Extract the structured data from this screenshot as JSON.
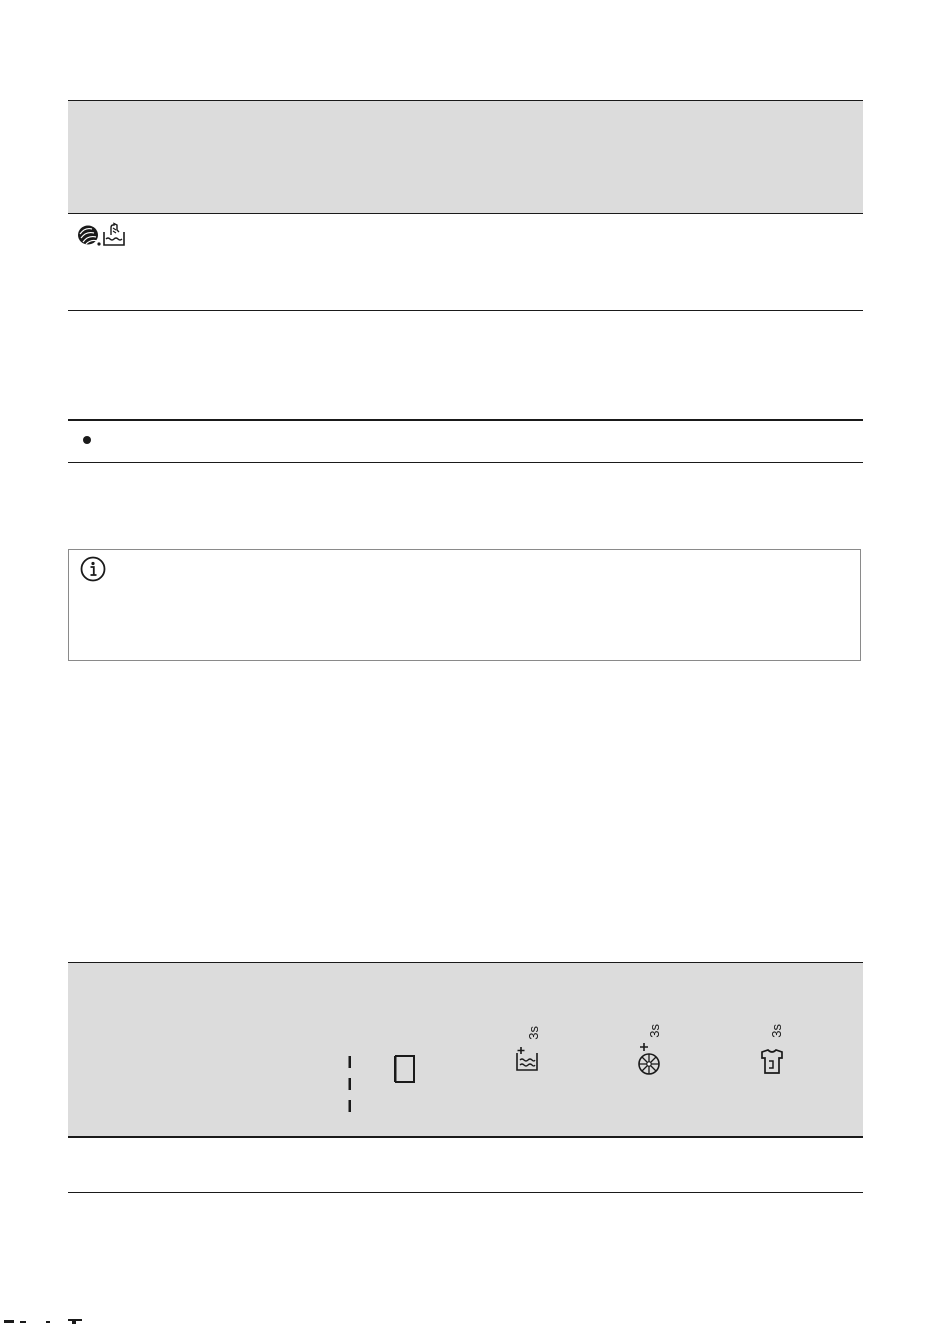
{
  "page": {
    "background": "#ffffff",
    "header_band_color": "#dcdcdc",
    "rule_color": "#1a1a1a",
    "note_border_color": "#8a8a8a"
  },
  "program_table": {
    "row_icons": [
      "wool-icon",
      "hand-wash-icon"
    ],
    "bullet_icon": "bullet-dot"
  },
  "info_note": {
    "icon": "info-icon"
  },
  "display_table": {
    "symbols": [
      {
        "name": "indicator-dashes-icon"
      },
      {
        "name": "door-icon"
      },
      {
        "name": "extra-rinse-icon",
        "label": "3s"
      },
      {
        "name": "child-lock-icon",
        "label": "3s"
      },
      {
        "name": "prewash-icon",
        "label": "3s"
      }
    ]
  }
}
